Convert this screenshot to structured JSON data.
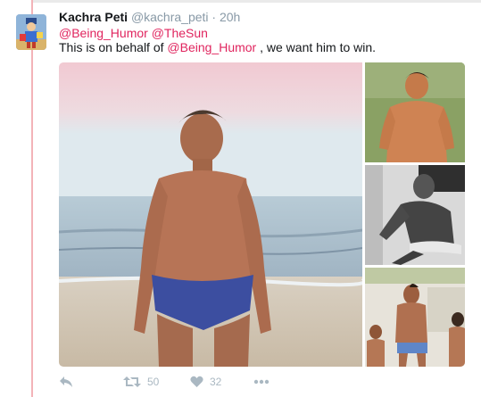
{
  "tweet": {
    "author_name": "Kachra Peti",
    "author_handle": "@kachra_peti",
    "separator": "·",
    "timestamp": "20h",
    "mentions": [
      "@Being_Humor",
      "@TheSun"
    ],
    "text_before": "This is on behalf of ",
    "text_mention": "@Being_Humor",
    "text_after": " , we want him to win."
  },
  "media": {
    "photo_count": 4
  },
  "actions": {
    "reply_icon": "reply-icon",
    "retweet_icon": "retweet-icon",
    "retweet_count": "50",
    "like_icon": "heart-icon",
    "like_count": "32",
    "more_icon": "more-dots-icon"
  },
  "colors": {
    "mention": "#e0245e",
    "muted": "#8899a6",
    "action": "#aab8c2",
    "thread_line": "#f3b3b8"
  }
}
